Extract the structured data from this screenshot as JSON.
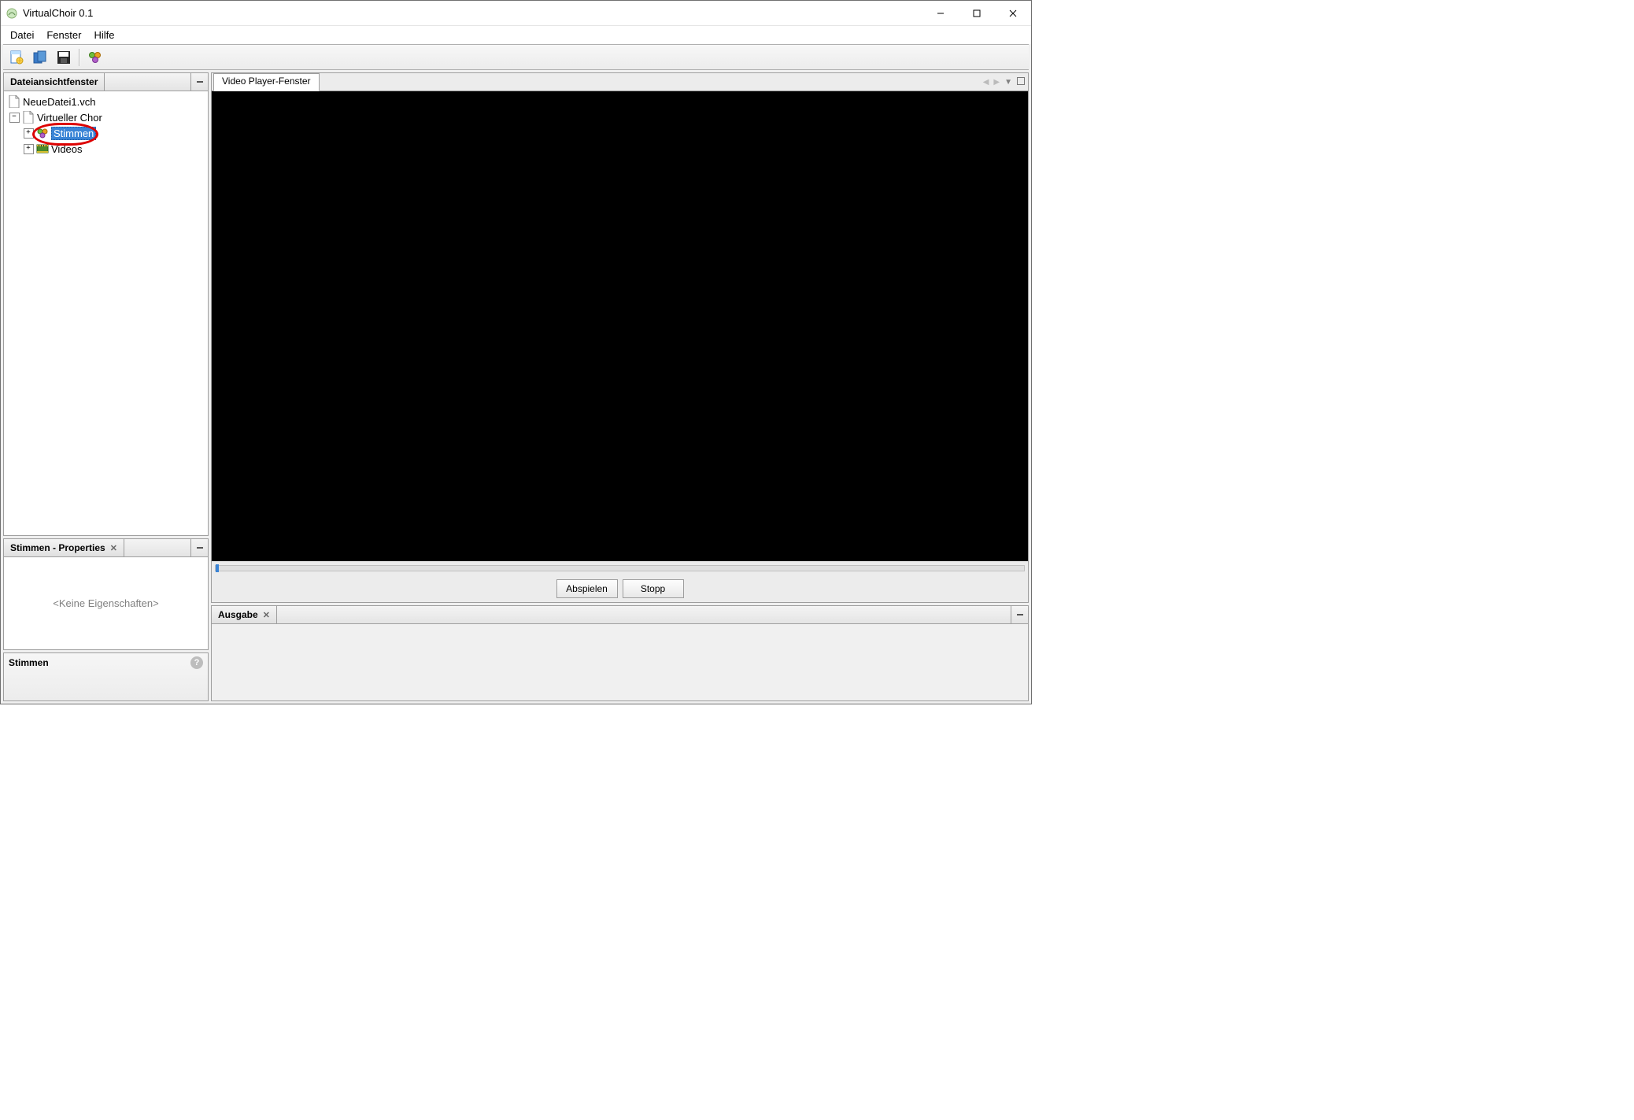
{
  "window": {
    "title": "VirtualChoir 0.1"
  },
  "menu": {
    "file": "Datei",
    "window": "Fenster",
    "help": "Hilfe"
  },
  "sidebar": {
    "tab_title": "Dateiansichtfenster",
    "tree": {
      "root": "NeueDatei1.vch",
      "group": "Virtueller Chor",
      "voices": "Stimmen",
      "videos": "Videos"
    }
  },
  "properties": {
    "tab_title": "Stimmen - Properties",
    "empty_text": "<Keine Eigenschaften>"
  },
  "selection_strip": {
    "title": "Stimmen"
  },
  "video": {
    "tab_title": "Video Player-Fenster",
    "play_btn": "Abspielen",
    "stop_btn": "Stopp"
  },
  "output": {
    "tab_title": "Ausgabe"
  }
}
